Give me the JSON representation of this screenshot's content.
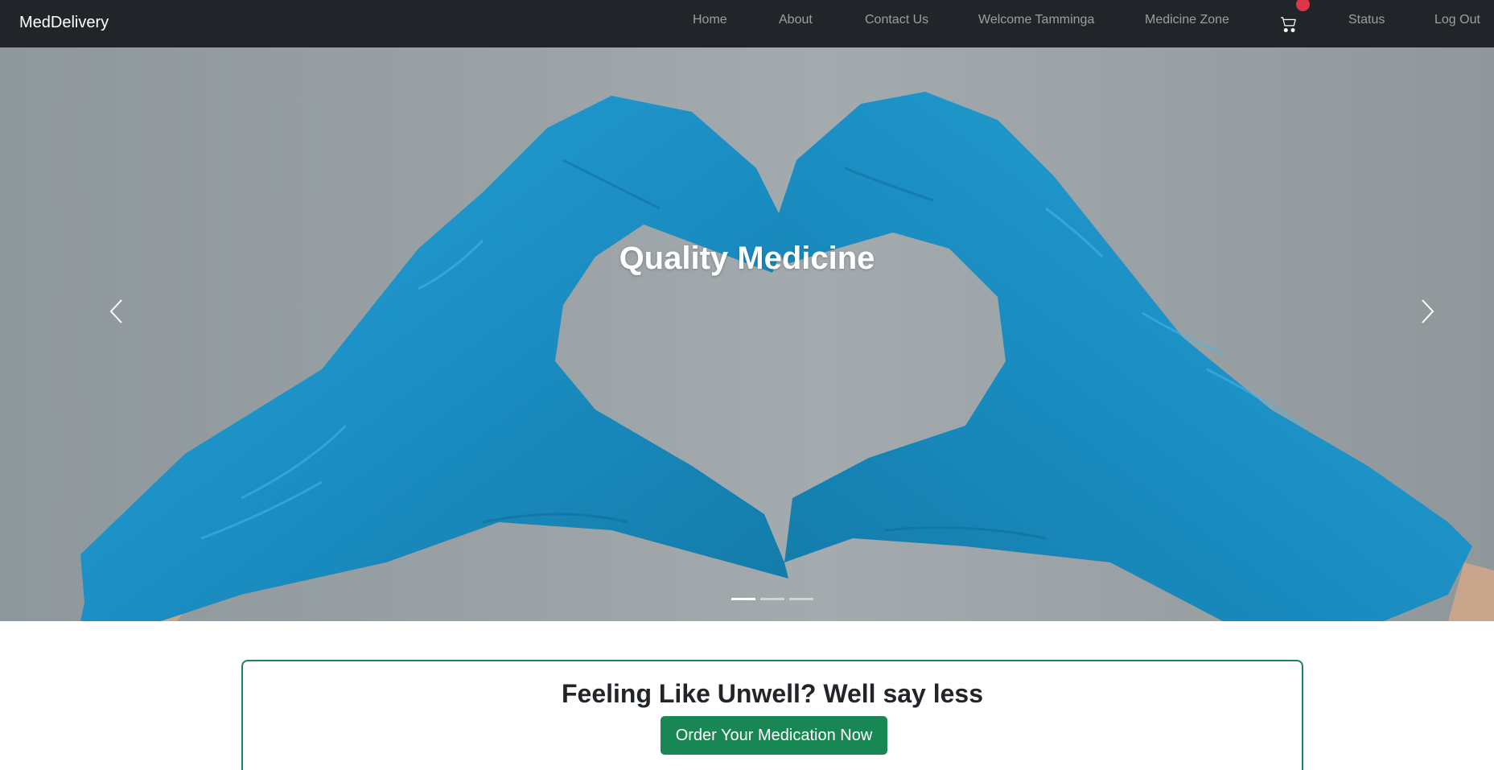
{
  "navbar": {
    "brand": "MedDelivery",
    "items": [
      {
        "label": "Home"
      },
      {
        "label": "About"
      },
      {
        "label": "Contact Us"
      },
      {
        "label": "Welcome Tamminga"
      },
      {
        "label": "Medicine Zone"
      },
      {
        "label": "Status"
      },
      {
        "label": "Log Out"
      }
    ],
    "cart_icon": "shopping-cart-icon",
    "cart_badge_color": "#dc3545"
  },
  "carousel": {
    "caption": "Quality Medicine",
    "slide_count": 3,
    "active_slide": 1,
    "prev_icon": "chevron-left-icon",
    "next_icon": "chevron-right-icon"
  },
  "cta": {
    "title": "Feeling Like Unwell? Well say less",
    "button_label": "Order Your Medication Now"
  },
  "colors": {
    "navbar_bg": "#212529",
    "accent_green": "#198754",
    "glove_blue": "#1b8fc4"
  }
}
